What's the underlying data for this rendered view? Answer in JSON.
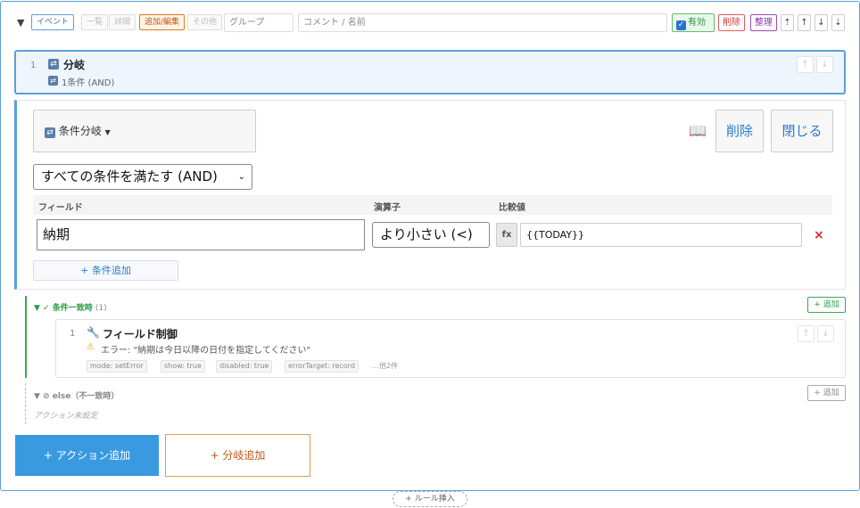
{
  "toolbar": {
    "collapse": "▼",
    "event": "イベント",
    "list": "一覧",
    "detail": "詳細",
    "add_edit": "追加/編集",
    "other": "その他",
    "group_placeholder": "グループ",
    "comment_placeholder": "コメント / 名前",
    "enabled": "有効",
    "delete": "削除",
    "organize": "整理",
    "arrows": [
      "⇡",
      "↑",
      "↓",
      "⇣"
    ]
  },
  "branch": {
    "number": "1",
    "title": "分岐",
    "summary": "1条件 (AND)",
    "up": "↑",
    "down": "↓"
  },
  "editor": {
    "type": "条件分岐",
    "delete": "削除",
    "close": "閉じる",
    "match_mode": "すべての条件を満たす (AND)",
    "columns": {
      "field": "フィールド",
      "operator": "演算子",
      "value": "比較値"
    },
    "condition": {
      "field": "納期",
      "operator": "より小さい (<)",
      "fx": "fx",
      "value": "{{TODAY}}",
      "remove": "×"
    },
    "add_condition": "+ 条件追加"
  },
  "then": {
    "label": "▼ ✓ 条件一致時",
    "count": "(1)",
    "add": "+ 追加",
    "action": {
      "number": "1",
      "title": "フィールド制御",
      "error": "エラー: \"納期は今日以降の日付を指定してください\"",
      "tags": [
        "mode: setError",
        "show: true",
        "disabled: true",
        "errorTarget: record"
      ],
      "more": "…他2件",
      "up": "↑",
      "down": "↓"
    }
  },
  "else": {
    "label": "▼ ⊘ else（不一致時）",
    "add": "+ 追加",
    "empty": "アクション未設定"
  },
  "footer": {
    "add_action": "+ アクション追加",
    "add_branch": "+ 分岐追加",
    "insert_rule": "+ ルール挿入"
  }
}
